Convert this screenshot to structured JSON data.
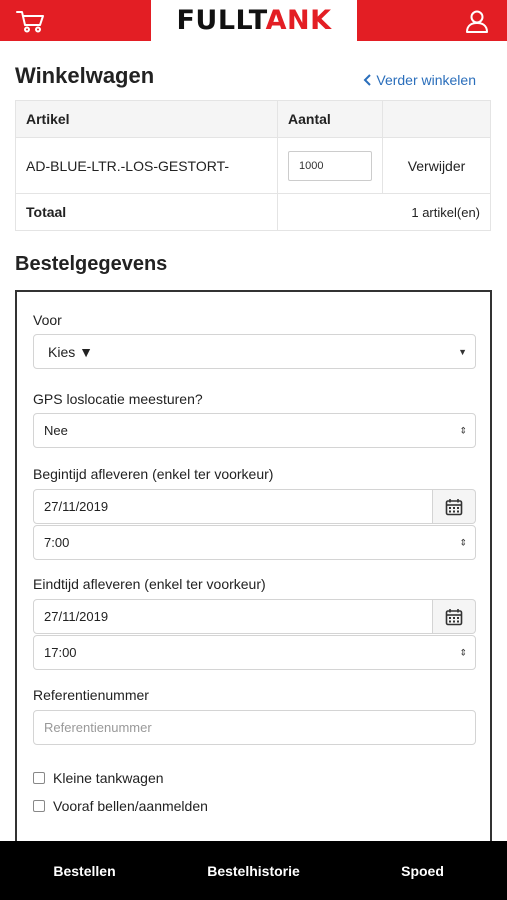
{
  "header": {
    "logo_part1": "FULLT",
    "logo_part2": "ANK",
    "cart_icon": "cart-icon",
    "user_icon": "user-icon",
    "brand_color": "#e31e24"
  },
  "cart": {
    "title": "Winkelwagen",
    "back_link": "Verder winkelen",
    "col_article": "Artikel",
    "col_quantity": "Aantal",
    "item_name": "AD-BLUE-LTR.-LOS-GESTORT-",
    "item_quantity": "1000",
    "remove_label": "Verwijder",
    "total_label": "Totaal",
    "total_value": "1 artikel(en)"
  },
  "order": {
    "title": "Bestelgegevens",
    "voor_label": "Voor",
    "voor_value": "Kies ▼",
    "gps_label": "GPS loslocatie meesturen?",
    "gps_value": "Nee",
    "start_label": "Begintijd afleveren (enkel ter voorkeur)",
    "start_date": "27/11/2019",
    "start_time": "7:00",
    "end_label": "Eindtijd afleveren (enkel ter voorkeur)",
    "end_date": "27/11/2019",
    "end_time": "17:00",
    "ref_label": "Referentienummer",
    "ref_placeholder": "Referentienummer",
    "check_small_truck": "Kleine tankwagen",
    "check_call_ahead": "Vooraf bellen/aanmelden"
  },
  "nav": {
    "order": "Bestellen",
    "history": "Bestelhistorie",
    "urgent": "Spoed"
  }
}
